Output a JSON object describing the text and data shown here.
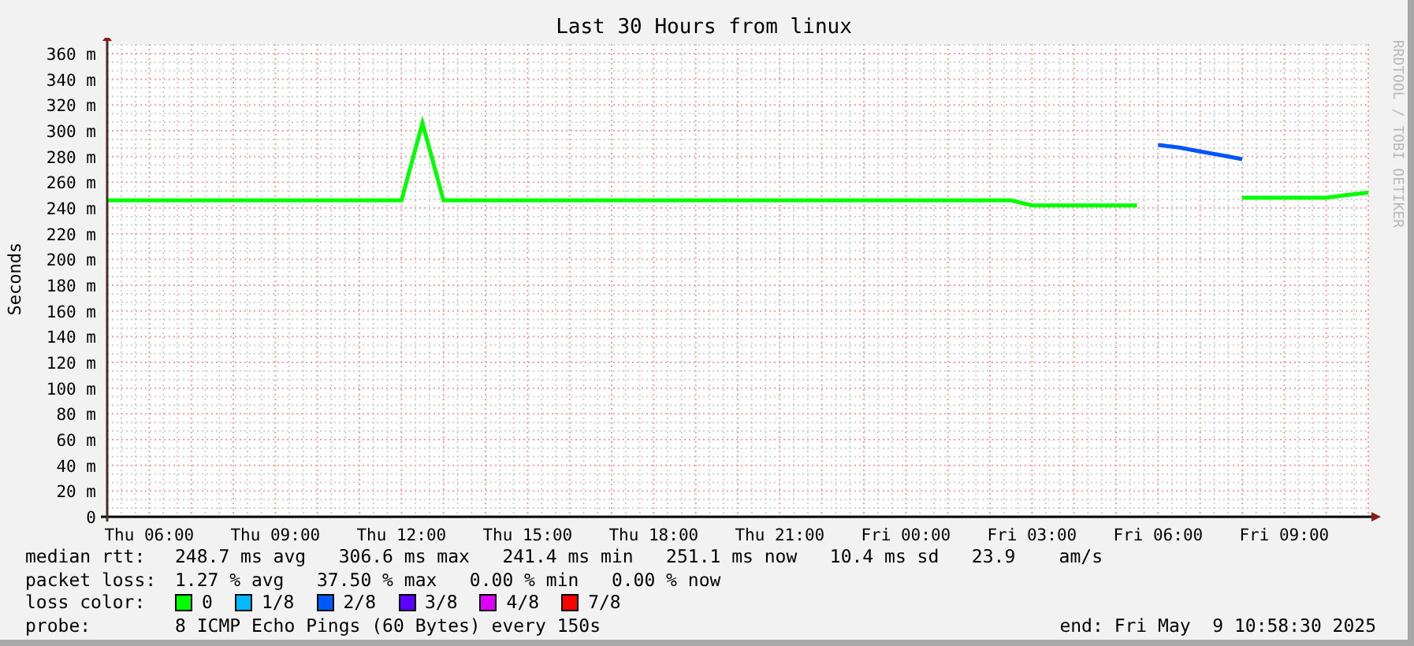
{
  "title": "Last 30 Hours from linux",
  "credit": "RRDTOOL / TOBI OETIKER",
  "chart_data": {
    "type": "line",
    "grid": true,
    "ylabel": "Seconds",
    "ylim": [
      0,
      360
    ],
    "categories": [
      null,
      null,
      "Thu 06:00",
      null,
      null,
      null,
      null,
      null,
      "Thu 09:00",
      null,
      null,
      null,
      null,
      null,
      "Thu 12:00",
      null,
      null,
      null,
      null,
      null,
      "Thu 15:00",
      null,
      null,
      null,
      null,
      null,
      "Thu 18:00",
      null,
      null,
      null,
      null,
      null,
      "Thu 21:00",
      null,
      null,
      null,
      null,
      null,
      "Fri 00:00",
      null,
      null,
      null,
      null,
      null,
      "Fri 03:00",
      null,
      null,
      null,
      null,
      null,
      "Fri 06:00",
      null,
      null,
      null,
      null,
      null,
      "Fri 09:00",
      null,
      null,
      null,
      null
    ],
    "series": [
      {
        "color": "#00ff00",
        "values": [
          246,
          246,
          246,
          246,
          246,
          246,
          246,
          246,
          246,
          246,
          246,
          246,
          246,
          246,
          246,
          306,
          246,
          246,
          246,
          246,
          246,
          246,
          246,
          246,
          246,
          246,
          246,
          246,
          246,
          246,
          246,
          246,
          246,
          246,
          246,
          246,
          246,
          246,
          246,
          246,
          246,
          246,
          246,
          246,
          242,
          242,
          242,
          242,
          242,
          242,
          null,
          null,
          null,
          null,
          248,
          248,
          248,
          248,
          248,
          250,
          252
        ]
      },
      {
        "color": "#0055ff",
        "values": [
          null,
          null,
          null,
          null,
          null,
          null,
          null,
          null,
          null,
          null,
          null,
          null,
          null,
          null,
          null,
          null,
          null,
          null,
          null,
          null,
          null,
          null,
          null,
          null,
          null,
          null,
          null,
          null,
          null,
          null,
          null,
          null,
          null,
          null,
          null,
          null,
          null,
          null,
          null,
          null,
          null,
          null,
          null,
          null,
          null,
          null,
          null,
          null,
          null,
          null,
          289,
          287,
          284,
          281,
          278,
          null,
          null,
          null,
          null,
          null,
          null
        ]
      }
    ],
    "yticks": [
      {
        "value": 0,
        "label": "0"
      },
      {
        "value": 20,
        "label": "20 m"
      },
      {
        "value": 40,
        "label": "40 m"
      },
      {
        "value": 60,
        "label": "60 m"
      },
      {
        "value": 80,
        "label": "80 m"
      },
      {
        "value": 100,
        "label": "100 m"
      },
      {
        "value": 120,
        "label": "120 m"
      },
      {
        "value": 140,
        "label": "140 m"
      },
      {
        "value": 160,
        "label": "160 m"
      },
      {
        "value": 180,
        "label": "180 m"
      },
      {
        "value": 200,
        "label": "200 m"
      },
      {
        "value": 220,
        "label": "220 m"
      },
      {
        "value": 240,
        "label": "240 m"
      },
      {
        "value": 260,
        "label": "260 m"
      },
      {
        "value": 280,
        "label": "280 m"
      },
      {
        "value": 300,
        "label": "300 m"
      },
      {
        "value": 320,
        "label": "320 m"
      },
      {
        "value": 340,
        "label": "340 m"
      },
      {
        "value": 360,
        "label": "360 m"
      }
    ]
  },
  "legend": {
    "median_rtt": {
      "label": "median rtt:",
      "text": "248.7 ms avg   306.6 ms max   241.4 ms min   251.1 ms now   10.4 ms sd   23.9    am/s"
    },
    "packet_loss": {
      "label": "packet loss:",
      "text": "1.27 % avg   37.50 % max   0.00 % min   0.00 % now"
    },
    "loss_color": {
      "label": "loss color:",
      "items": [
        {
          "label": "0",
          "color": "#00ff00"
        },
        {
          "label": "1/8",
          "color": "#00b8ff"
        },
        {
          "label": "2/8",
          "color": "#0059ff"
        },
        {
          "label": "3/8",
          "color": "#5e00ff"
        },
        {
          "label": "4/8",
          "color": "#dd00ff"
        },
        {
          "label": "7/8",
          "color": "#ff0000"
        }
      ]
    },
    "probe": {
      "label": "probe:",
      "text": "8 ICMP Echo Pings (60 Bytes) every 150s"
    },
    "end": "end: Fri May  9 10:58:30 2025"
  }
}
